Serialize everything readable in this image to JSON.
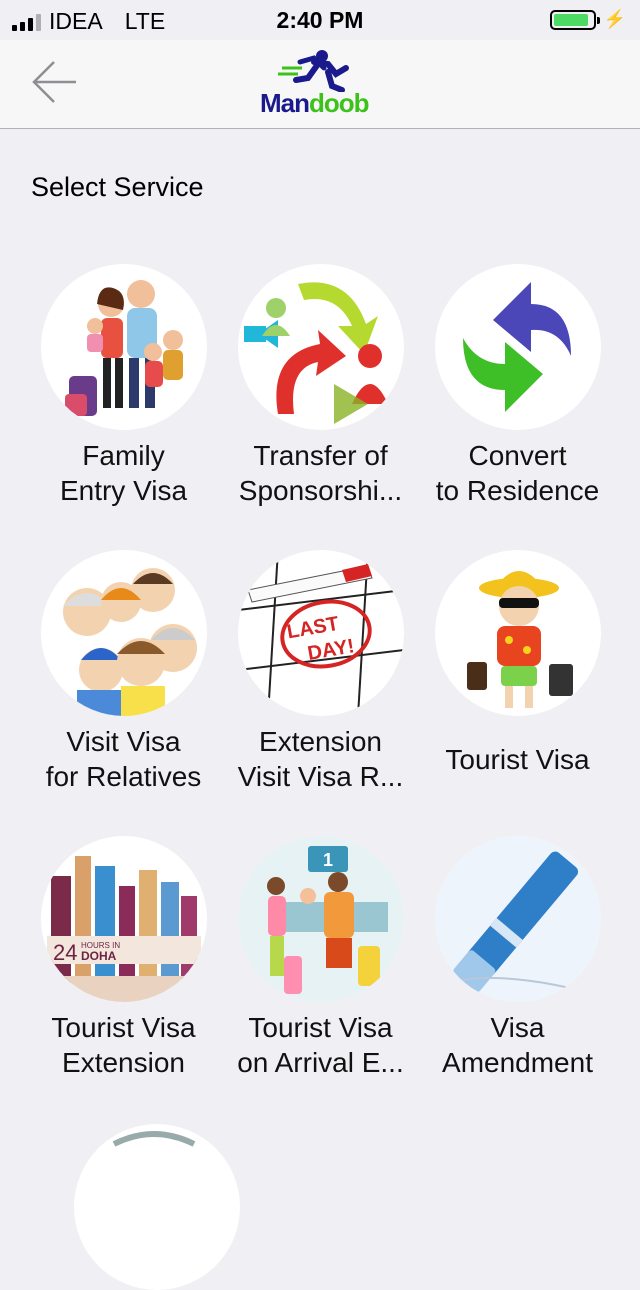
{
  "status_bar": {
    "carrier": "IDEA",
    "network": "LTE",
    "time": "2:40 PM",
    "battery_level": 0.85
  },
  "nav": {
    "back_icon": "back-arrow-icon",
    "logo_text_part1": "Man",
    "logo_text_part2": "doob",
    "brand_colors": {
      "primary": "#1a1a8c",
      "accent": "#3cc21a"
    }
  },
  "page": {
    "heading": "Select Service"
  },
  "services": [
    {
      "label": "Family\nEntry Visa",
      "icon": "family-icon"
    },
    {
      "label": "Transfer of\nSponsorshi...",
      "icon": "transfer-arrows-icon"
    },
    {
      "label": "Convert\nto Residence",
      "icon": "convert-arrows-icon"
    },
    {
      "label": "Visit Visa\nfor Relatives",
      "icon": "relatives-icon"
    },
    {
      "label": "Extension\nVisit Visa R...",
      "icon": "calendar-last-day-icon"
    },
    {
      "label": "Tourist Visa",
      "icon": "tourist-icon"
    },
    {
      "label": "Tourist Visa\nExtension",
      "icon": "doha-skyline-icon"
    },
    {
      "label": "Tourist Visa\non Arrival E...",
      "icon": "airport-counter-icon"
    },
    {
      "label": "Visa\nAmendment",
      "icon": "pen-icon"
    }
  ],
  "icon_texts": {
    "last_day": "LAST\nDAY!",
    "hours_24": "24",
    "hours_in": "HOURS IN",
    "doha": "DOHA",
    "counter_number": "1"
  }
}
